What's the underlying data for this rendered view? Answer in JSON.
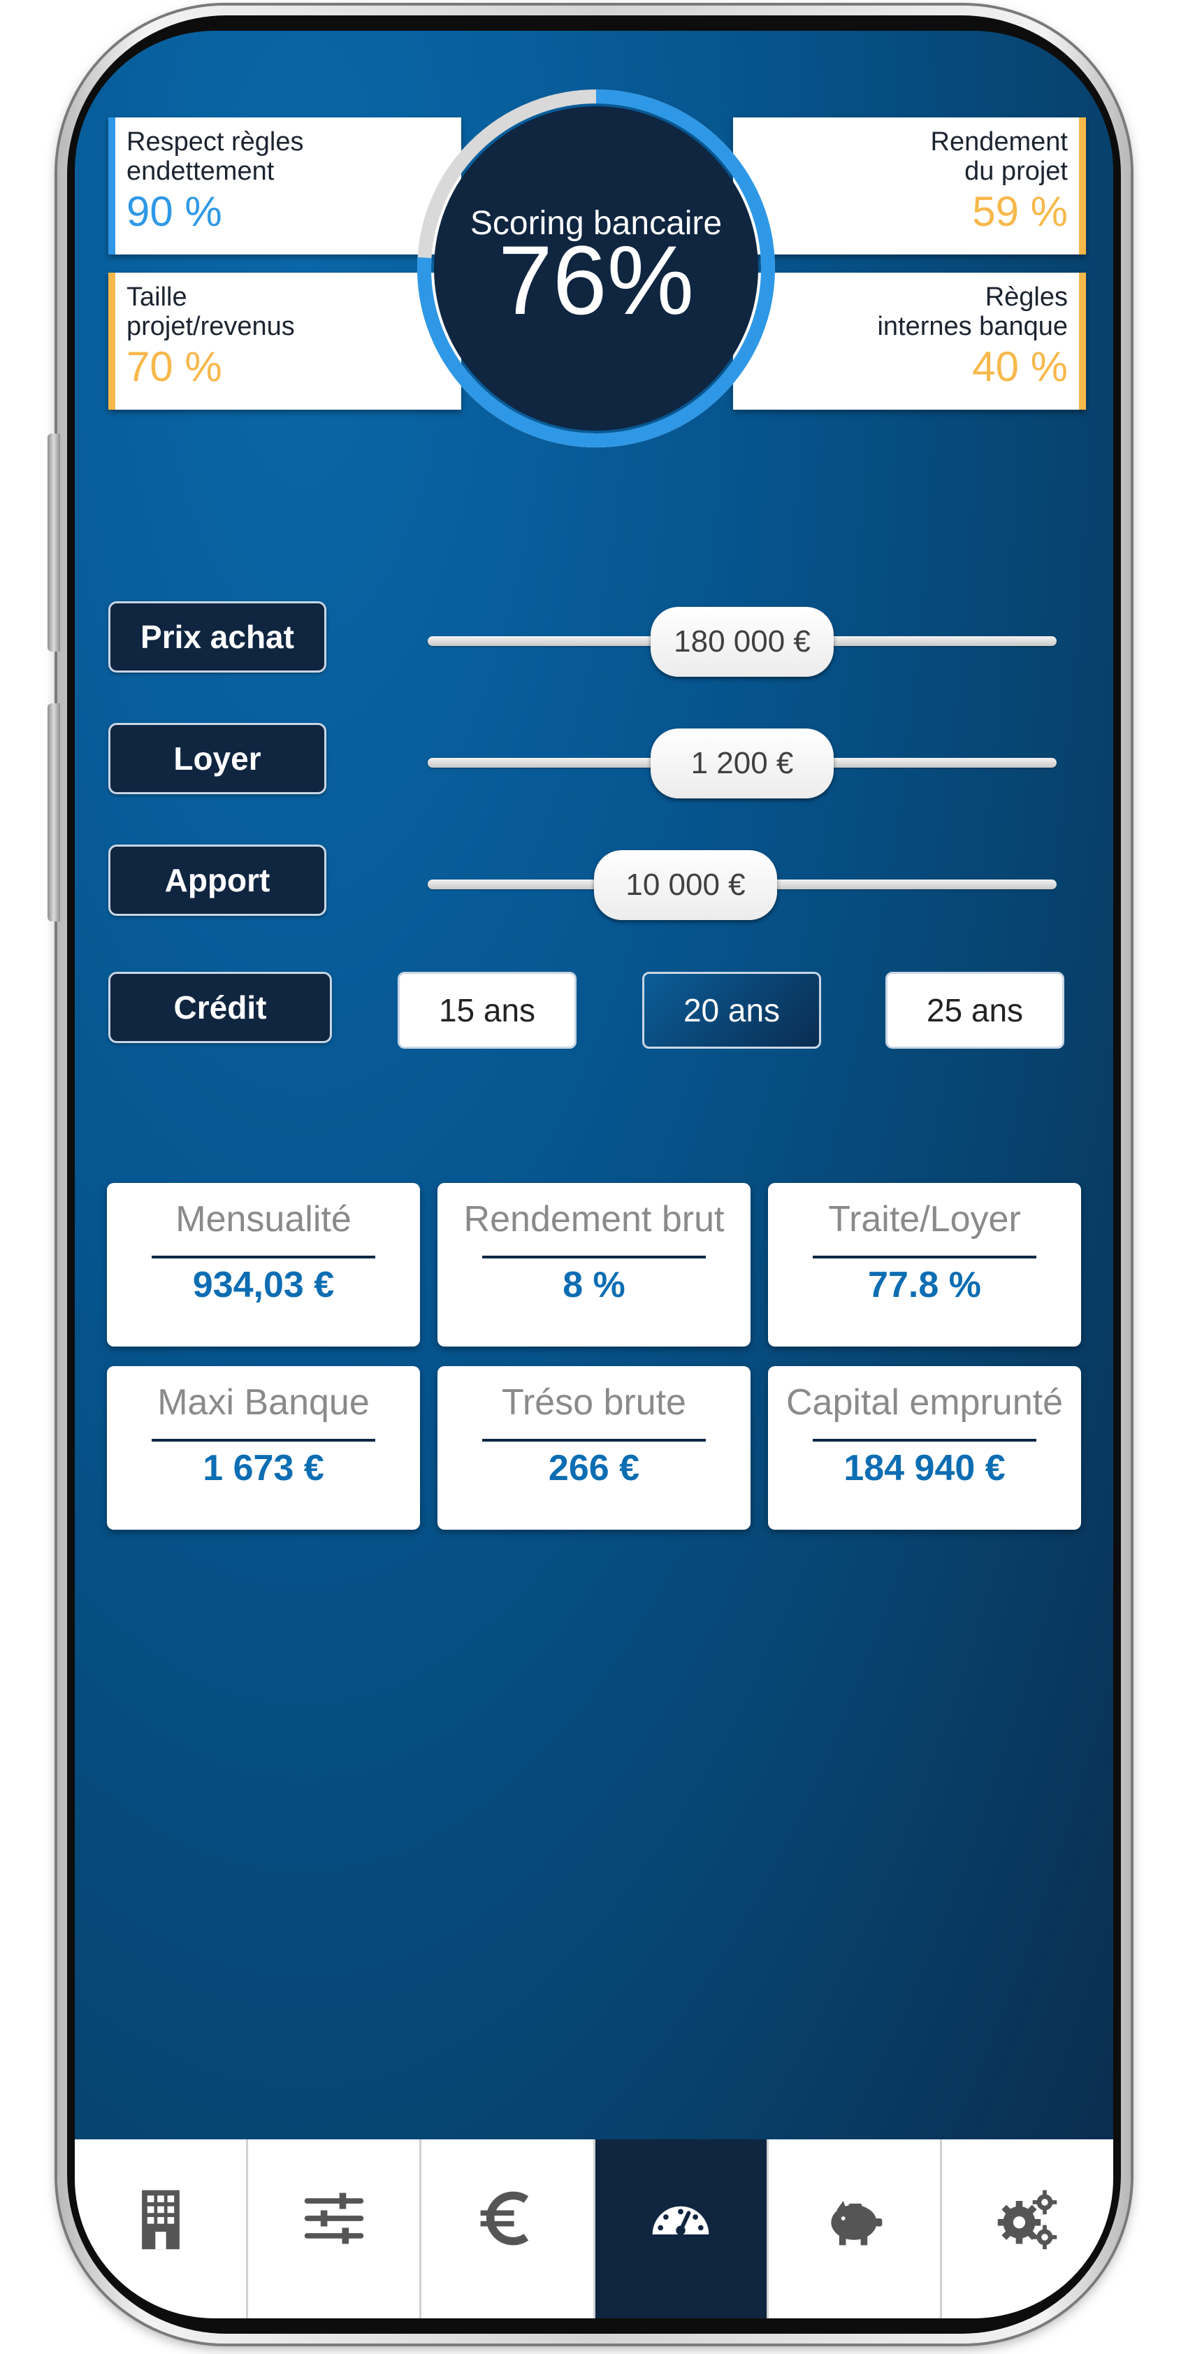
{
  "info_cards": {
    "top_left": {
      "label": "Respect règles\nendettement",
      "value": "90 %",
      "color": "#2f98e6"
    },
    "top_right": {
      "label": "Rendement\ndu projet",
      "value": "59 %",
      "color": "#f7b84b"
    },
    "bottom_left": {
      "label": "Taille\nprojet/revenus",
      "value": "70 %",
      "color": "#f7b84b"
    },
    "bottom_right": {
      "label": "Règles\ninternes banque",
      "value": "40 %",
      "color": "#f7b84b"
    }
  },
  "gauge": {
    "title": "Scoring bancaire",
    "value": "76%",
    "level": 0.76,
    "color": "#2f98e6"
  },
  "sliders": [
    {
      "label": "Prix achat",
      "value": "180 000 €",
      "position": 0.5
    },
    {
      "label": "Loyer",
      "value": "1 200 €",
      "position": 0.5
    },
    {
      "label": "Apport",
      "value": "10 000 €",
      "position": 0.41
    }
  ],
  "credit": {
    "label": "Crédit",
    "options": [
      "15 ans",
      "20 ans",
      "25 ans"
    ],
    "selected": "20 ans"
  },
  "stats": [
    {
      "title": "Mensualité",
      "value": "934,03 €"
    },
    {
      "title": "Rendement brut",
      "value": "8 %"
    },
    {
      "title": "Traite/Loyer",
      "value": "77.8 %"
    },
    {
      "title": "Maxi Banque",
      "value": "1 673 €"
    },
    {
      "title": "Tréso brute",
      "value": "266 €"
    },
    {
      "title": "Capital emprunté",
      "value": "184 940 €"
    }
  ],
  "nav": {
    "items": [
      "building-icon",
      "sliders-icon",
      "euro-icon",
      "speedometer-icon",
      "piggy-bank-icon",
      "gears-icon"
    ],
    "active": "speedometer-icon"
  },
  "colors": {
    "accent_blue": "#2f98e6",
    "accent_yellow": "#f7b84b",
    "navy": "#0f2540",
    "stat_value": "#0d6db3"
  }
}
